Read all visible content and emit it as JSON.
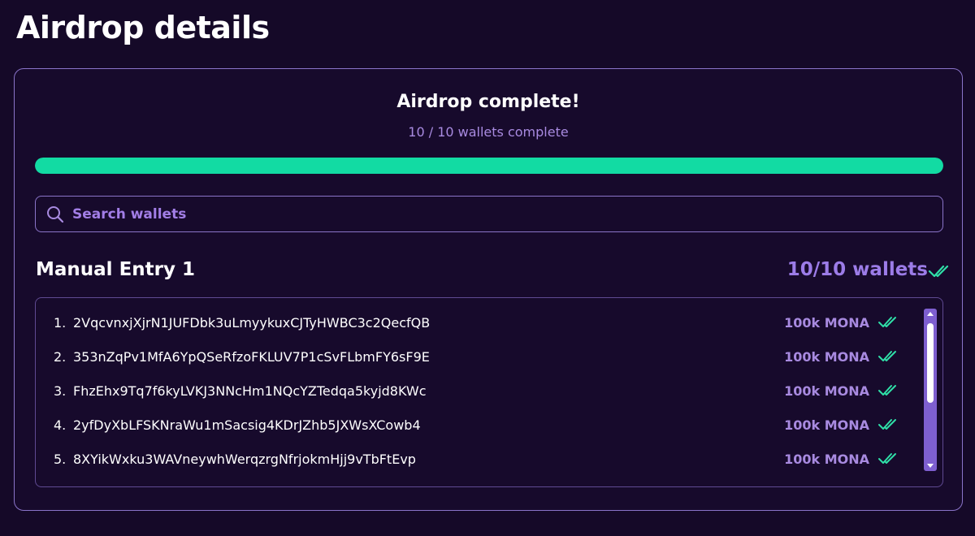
{
  "page": {
    "title": "Airdrop details"
  },
  "status": {
    "title": "Airdrop complete!",
    "subtitle": "10 / 10 wallets complete",
    "progress_fraction": 1.0
  },
  "search": {
    "placeholder": "Search wallets",
    "value": ""
  },
  "group": {
    "title": "Manual Entry 1",
    "count_label": "10/10 wallets",
    "check_icon": "double-check-icon"
  },
  "wallets": [
    {
      "index": "1.",
      "address": "2VqcvnxjXjrN1JUFDbk3uLmyykuxCJTyHWBC3c2QecfQB",
      "amount": "100k MONA"
    },
    {
      "index": "2.",
      "address": "353nZqPv1MfA6YpQSeRfzoFKLUV7P1cSvFLbmFY6sF9E",
      "amount": "100k MONA"
    },
    {
      "index": "3.",
      "address": "FhzEhx9Tq7f6kyLVKJ3NNcHm1NQcYZTedqa5kyjd8KWc",
      "amount": "100k MONA"
    },
    {
      "index": "4.",
      "address": "2yfDyXbLFSKNraWu1mSacsig4KDrJZhb5JXWsXCowb4",
      "amount": "100k MONA"
    },
    {
      "index": "5.",
      "address": "8XYikWxku3WAVneywhWerqzrgNfrjokmHjj9vTbFtEvp",
      "amount": "100k MONA"
    }
  ],
  "colors": {
    "background": "#150928",
    "accent_purple": "#a88ae0",
    "progress_green": "#12dba3",
    "check_green": "#2fe0a8",
    "border_purple": "#8a74c9"
  },
  "icons": [
    "search-icon",
    "double-check-icon",
    "scroll-up-arrow-icon",
    "scroll-down-arrow-icon"
  ]
}
